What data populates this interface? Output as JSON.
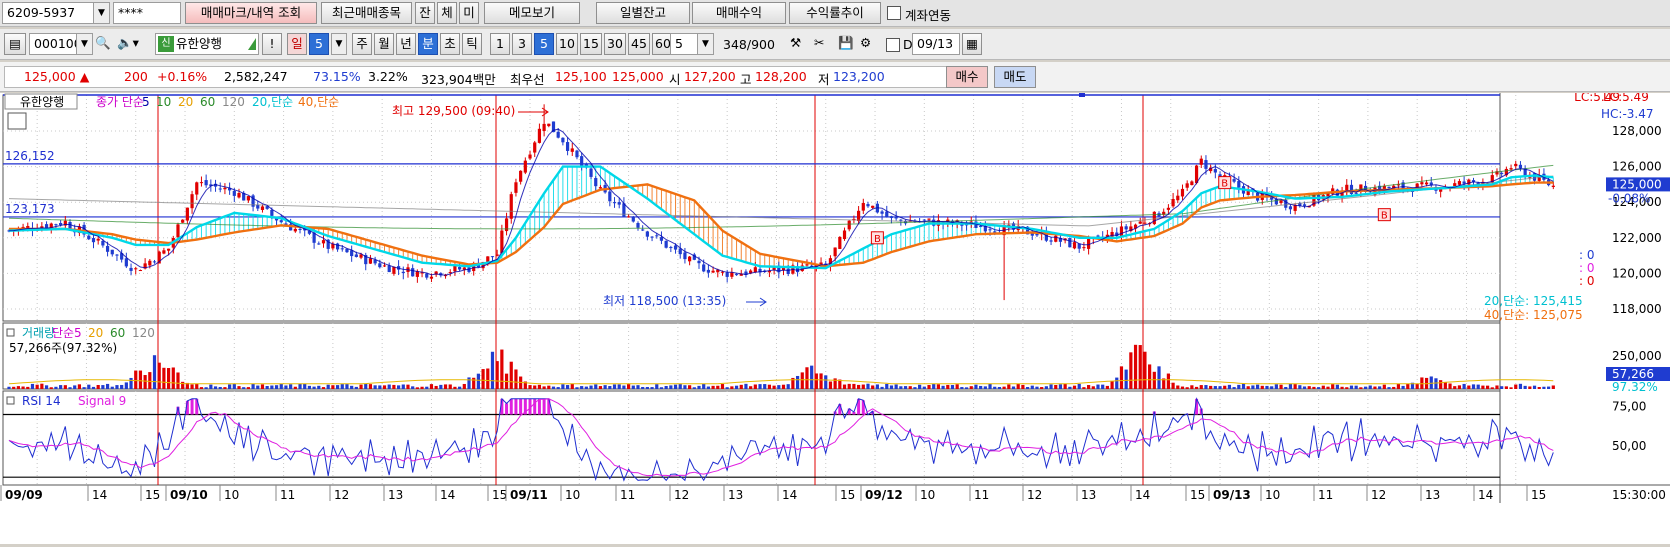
{
  "toolbar1": {
    "account": "6209-5937",
    "password": "****",
    "trade_mark_btn": "매매마크/내역 조회",
    "recent_items_btn": "최근매매종목",
    "jan_btn": "잔",
    "che_btn": "체",
    "mi_btn": "미",
    "memo_btn": "메모보기",
    "daily_balance_btn": "일별잔고",
    "trade_profit_btn": "매매수익",
    "profit_trend_btn": "수익률추이",
    "account_link_label": "계좌연동"
  },
  "toolbar2": {
    "code": "000100",
    "stock_badge": "신",
    "stock_name": "유한양행",
    "alert_btn": "!",
    "period_day": "일",
    "period_value": "5",
    "periods": [
      "주",
      "월",
      "년",
      "분",
      "초",
      "틱"
    ],
    "active_period": "분",
    "intervals": [
      "1",
      "3",
      "5",
      "10",
      "15",
      "30",
      "45",
      "60"
    ],
    "active_interval": "5",
    "interval_select": "5",
    "count": "348",
    "count_total": "/900",
    "date_flag": "D",
    "date": "09/13"
  },
  "quote": {
    "price": "125,000",
    "arrow": "▲",
    "change": "200",
    "change_pct": "+0.16%",
    "volume": "2,582,247",
    "ratio1": "73.15%",
    "ratio2": "3.22%",
    "amount": "323,904백만",
    "best_label": "최우선",
    "best_ask": "125,100",
    "best_bid": "125,000",
    "open_label": "시",
    "open": "127,200",
    "high_label": "고",
    "high": "128,200",
    "low_label": "저",
    "low": "123,200",
    "buy_btn": "매수",
    "sell_btn": "매도"
  },
  "colors": {
    "up": "#e00000",
    "down": "#1f3cd0",
    "ma5": "#0000aa",
    "ma20": "#00d8e8",
    "ma40": "#f07010",
    "volume_up": "#e00000",
    "volume_down": "#1f3cd0",
    "rsi": "#1f2fd0",
    "signal": "#e020e0",
    "hline": "#1f2fd0",
    "vline": "#e00000"
  },
  "chart_data": [
    {
      "type": "candlestick",
      "panel": "price",
      "legend": [
        "유한양행",
        "종가 단순",
        "5",
        "10",
        "20",
        "60",
        "120",
        "20,단순",
        "40,단순"
      ],
      "ylim": [
        117500,
        129800
      ],
      "y_ticks": [
        "128,000",
        "126,000",
        "124,000",
        "122,000",
        "120,000",
        "118,000"
      ],
      "current_price_label": "125,000",
      "current_change_label": "-0.08%",
      "lc_label": "LC:5.49",
      "hc_label": "HC:-3.47",
      "hlines": [
        {
          "label": "126,152",
          "value": 126152
        },
        {
          "label": "123,173",
          "value": 123173
        }
      ],
      "annotations": {
        "high": "최고 129,500 (09:40)",
        "low": "최저 118,500 (13:35)"
      },
      "side_markers": [
        ": 0",
        ": 0",
        ": 0"
      ],
      "ma_readout": [
        "20,단순: 125,415",
        "40,단순: 125,075"
      ],
      "x_ticks": [
        "09/09",
        "14",
        "15",
        "09/10",
        "10",
        "11",
        "12",
        "13",
        "14",
        "15",
        "09/11",
        "10",
        "11",
        "12",
        "13",
        "14",
        "15",
        "09/12",
        "10",
        "11",
        "12",
        "13",
        "14",
        "15",
        "09/13",
        "10",
        "11",
        "12",
        "13",
        "14",
        "15"
      ],
      "time_label": "15:30:00",
      "anchors": [
        {
          "x": 0,
          "y": 122.4
        },
        {
          "x": 12,
          "y": 122.9
        },
        {
          "x": 22,
          "y": 121.2
        },
        {
          "x": 27,
          "y": 120.2
        },
        {
          "x": 34,
          "y": 121.4
        },
        {
          "x": 40,
          "y": 125.1
        },
        {
          "x": 48,
          "y": 124.6
        },
        {
          "x": 58,
          "y": 122.9
        },
        {
          "x": 68,
          "y": 121.5
        },
        {
          "x": 80,
          "y": 120.4
        },
        {
          "x": 88,
          "y": 120.0
        },
        {
          "x": 98,
          "y": 120.3
        },
        {
          "x": 104,
          "y": 121.1
        },
        {
          "x": 108,
          "y": 125.3
        },
        {
          "x": 114,
          "y": 128.6
        },
        {
          "x": 118,
          "y": 127.5
        },
        {
          "x": 126,
          "y": 124.6
        },
        {
          "x": 136,
          "y": 122.3
        },
        {
          "x": 146,
          "y": 120.5
        },
        {
          "x": 152,
          "y": 120.0
        },
        {
          "x": 160,
          "y": 120.1
        },
        {
          "x": 174,
          "y": 120.4
        },
        {
          "x": 182,
          "y": 124.1
        },
        {
          "x": 188,
          "y": 123.0
        },
        {
          "x": 196,
          "y": 122.9
        },
        {
          "x": 206,
          "y": 122.7
        },
        {
          "x": 218,
          "y": 122.3
        },
        {
          "x": 228,
          "y": 121.5
        },
        {
          "x": 236,
          "y": 122.3
        },
        {
          "x": 244,
          "y": 123.2
        },
        {
          "x": 250,
          "y": 124.5
        },
        {
          "x": 254,
          "y": 126.3
        },
        {
          "x": 258,
          "y": 125.4
        },
        {
          "x": 266,
          "y": 124.3
        },
        {
          "x": 274,
          "y": 123.8
        },
        {
          "x": 284,
          "y": 124.7
        },
        {
          "x": 294,
          "y": 124.8
        },
        {
          "x": 306,
          "y": 124.9
        },
        {
          "x": 316,
          "y": 125.3
        },
        {
          "x": 320,
          "y": 126.0
        },
        {
          "x": 325,
          "y": 125.4
        },
        {
          "x": 329,
          "y": 124.9
        }
      ],
      "ma_values": {
        "ma20": [
          122.4,
          122.5,
          122.0,
          121.6,
          121.6,
          122.6,
          123.4,
          123.1,
          122.1,
          121.2,
          120.6,
          120.4,
          120.7,
          122.0,
          124.5,
          126.0,
          126.0,
          124.2,
          122.2,
          121.0,
          120.4,
          120.3,
          121.4,
          122.2,
          122.8,
          122.8,
          122.5,
          122.0,
          122.0,
          122.5,
          123.5,
          124.5,
          124.9,
          124.6,
          124.2,
          124.3,
          124.6,
          124.8,
          125.0,
          125.4,
          125.5,
          125.4
        ],
        "ma40": [
          122.5,
          122.5,
          122.2,
          121.9,
          121.7,
          121.9,
          122.3,
          122.7,
          122.5,
          121.6,
          121.0,
          120.5,
          120.6,
          121.2,
          122.6,
          123.9,
          124.7,
          125.0,
          124.1,
          122.4,
          121.1,
          120.4,
          120.6,
          121.2,
          121.8,
          122.2,
          122.3,
          122.1,
          121.8,
          122.1,
          122.8,
          123.7,
          124.1,
          124.3,
          124.4,
          124.6,
          124.7,
          124.8,
          124.9,
          125.0,
          125.1,
          125.1
        ]
      }
    },
    {
      "type": "bar",
      "panel": "volume",
      "legend": [
        "거래량",
        "단순",
        "5",
        "20",
        "60",
        "120"
      ],
      "info": "57,266주(97.32%)",
      "y_ticks": [
        "250,000"
      ],
      "current_label": "57,266",
      "current_pct": "97.32%",
      "peaks": [
        {
          "x": 158,
          "value": 250000
        },
        {
          "x": 496,
          "value": 230000
        },
        {
          "x": 815,
          "value": 140000
        },
        {
          "x": 1143,
          "value": 280000
        },
        {
          "x": 1428,
          "value": 75000
        }
      ]
    },
    {
      "type": "line",
      "panel": "rsi",
      "legend": [
        "RSI 14",
        "Signal 9"
      ],
      "ylim": [
        25,
        85
      ],
      "y_ticks": [
        "75,00",
        "50,00"
      ],
      "levels": [
        70,
        30
      ]
    }
  ]
}
